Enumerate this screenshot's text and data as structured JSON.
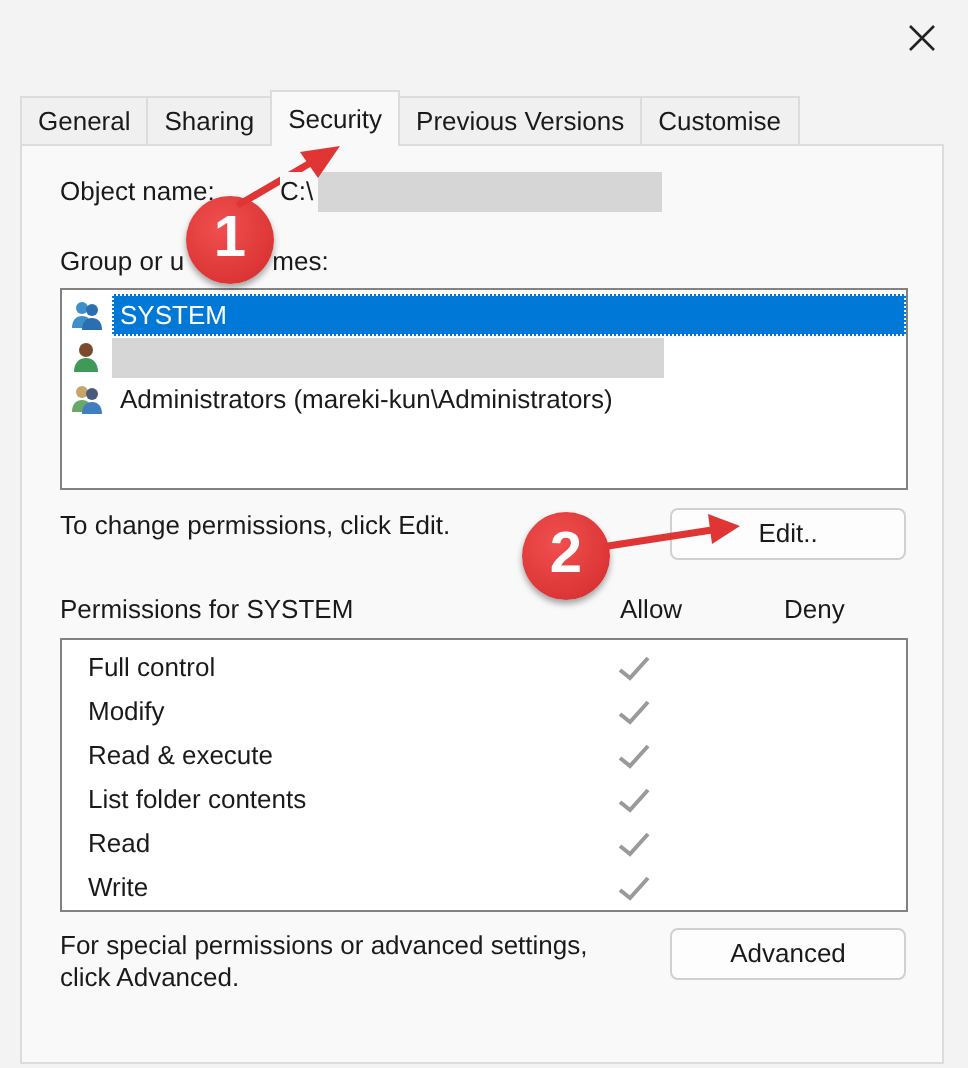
{
  "tabs": [
    {
      "label": "General",
      "selected": false
    },
    {
      "label": "Sharing",
      "selected": false
    },
    {
      "label": "Security",
      "selected": true
    },
    {
      "label": "Previous Versions",
      "selected": false
    },
    {
      "label": "Customise",
      "selected": false
    }
  ],
  "object_name": {
    "label": "Object name:",
    "value": "C:\\"
  },
  "group_label": [
    "Group or u",
    "mes:"
  ],
  "principals": [
    {
      "kind": "system",
      "name": "SYSTEM",
      "selected": true
    },
    {
      "kind": "user",
      "selected": false
    },
    {
      "kind": "group",
      "name": "Administrators (mareki-kun\\Administrators)",
      "selected": false
    }
  ],
  "edit_hint": "To change permissions, click Edit.",
  "edit_button": "Edit..",
  "permissions_title": "Permissions for SYSTEM",
  "columns": [
    "Allow",
    "Deny"
  ],
  "permissions": [
    {
      "name": "Full control",
      "allow": true,
      "deny": false
    },
    {
      "name": "Modify",
      "allow": true,
      "deny": false
    },
    {
      "name": "Read & execute",
      "allow": true,
      "deny": false
    },
    {
      "name": "List folder contents",
      "allow": true,
      "deny": false
    },
    {
      "name": "Read",
      "allow": true,
      "deny": false
    },
    {
      "name": "Write",
      "allow": true,
      "deny": false
    }
  ],
  "advanced_hint": "For special permissions or advanced settings, click Advanced.",
  "advanced_button": "Advanced",
  "callouts": [
    {
      "label": "1"
    },
    {
      "label": "2"
    }
  ]
}
